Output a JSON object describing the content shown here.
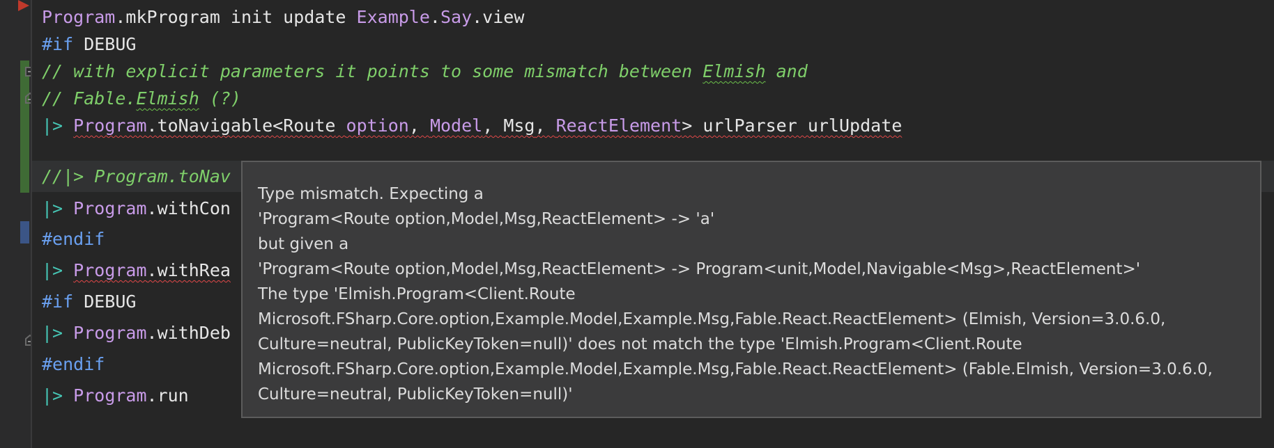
{
  "editor": {
    "lines": [
      {
        "parts": [
          "Program",
          ".mkProgram init update ",
          "Example",
          ".",
          "Say",
          ".view"
        ]
      },
      {
        "parts": [
          "#if",
          " DEBUG"
        ]
      },
      {
        "text": "// with explicit parameters it points to some mismatch between ",
        "word": "Elmish",
        "tail": " and"
      },
      {
        "text": "// Fable.",
        "word": "Elmish",
        "tail": " (?)"
      },
      {
        "parts": [
          "|>",
          " ",
          "Program",
          ".toNavigable<",
          "Route",
          " ",
          "option",
          ", ",
          "Model",
          ", ",
          "Msg",
          ", ",
          "ReactElement",
          "> urlParser urlUpdate"
        ]
      },
      {
        "text": "//|> Program.toNav"
      },
      {
        "parts": [
          "|>",
          " ",
          "Program",
          ".withCon"
        ]
      },
      {
        "parts": [
          "#endif"
        ]
      },
      {
        "parts": [
          "|>",
          " ",
          "Program",
          ".withRea"
        ]
      },
      {
        "parts": [
          "#if",
          " DEBUG"
        ]
      },
      {
        "parts": [
          "|>",
          " ",
          "Program",
          ".withDeb"
        ]
      },
      {
        "parts": [
          "#endif"
        ]
      },
      {
        "parts": [
          "|>",
          " ",
          "Program",
          ".run"
        ]
      }
    ]
  },
  "tooltip": {
    "lines": [
      "Type mismatch. Expecting a",
      "'Program<Route option,Model,Msg,ReactElement> -> 'a'",
      "but given a",
      "'Program<Route option,Model,Msg,ReactElement> -> Program<unit,Model,Navigable<Msg>,ReactElement>'",
      "The type 'Elmish.Program<Client.Route",
      "Microsoft.FSharp.Core.option,Example.Model,Example.Msg,Fable.React.ReactElement> (Elmish, Version=3.0.6.0,",
      "Culture=neutral, PublicKeyToken=null)' does not match the type 'Elmish.Program<Client.Route",
      "Microsoft.FSharp.Core.option,Example.Model,Example.Msg,Fable.React.ReactElement> (Fable.Elmish, Version=3.0.6.0,",
      "Culture=neutral, PublicKeyToken=null)'"
    ]
  },
  "colors": {
    "background": "#262626",
    "keyword": "#6aa0f0",
    "module": "#c89be8",
    "comment": "#7fcf6a",
    "pipe": "#46c5b4",
    "error_squiggle": "#e04848",
    "tooltip_bg": "#3b3b3c"
  },
  "icons": [
    "breakpoint-marker-icon",
    "fold-start-icon",
    "fold-end-icon"
  ]
}
